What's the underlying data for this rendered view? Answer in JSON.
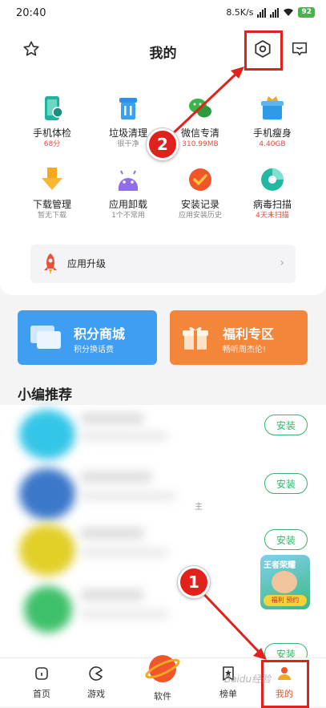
{
  "status_bar": {
    "time": "20:40",
    "speed": "8.5K/s",
    "battery": "92"
  },
  "header": {
    "title": "我的"
  },
  "tools": [
    {
      "label": "手机体检",
      "sub": "68分",
      "sub_red": true,
      "icon": "phone-check-icon",
      "color": "#23b09c"
    },
    {
      "label": "垃圾清理",
      "sub": "很干净",
      "sub_red": false,
      "icon": "trash-icon",
      "color": "#2f8fe6"
    },
    {
      "label": "微信专清",
      "sub": "310.99MB",
      "sub_red": true,
      "icon": "wechat-icon",
      "color": "#3ab54a"
    },
    {
      "label": "手机瘦身",
      "sub": "4.40GB",
      "sub_red": true,
      "icon": "slim-box-icon",
      "color": "#2f9be6"
    },
    {
      "label": "下载管理",
      "sub": "暂无下载",
      "sub_red": false,
      "icon": "download-icon",
      "color": "#f5a91a"
    },
    {
      "label": "应用卸载",
      "sub": "1个不常用",
      "sub_red": false,
      "icon": "android-icon",
      "color": "#8f6ee8"
    },
    {
      "label": "安装记录",
      "sub": "应用安装历史",
      "sub_red": false,
      "icon": "install-record-icon",
      "color": "#f0552c"
    },
    {
      "label": "病毒扫描",
      "sub": "4天未扫描",
      "sub_red": true,
      "icon": "virus-scan-icon",
      "color": "#22b8a1"
    }
  ],
  "upgrade": {
    "label": "应用升级"
  },
  "banners": {
    "points": {
      "title": "积分商城",
      "sub": "积分换话费",
      "color": "#3f9ef2"
    },
    "welfare": {
      "title": "福利专区",
      "sub": "畅听周杰伦!",
      "color": "#f4863a"
    }
  },
  "section": {
    "title": "小编推荐"
  },
  "apps": [
    {
      "install": "安装",
      "color": "#34c6e8"
    },
    {
      "install": "安装",
      "color": "#3b78c9"
    },
    {
      "install": "安装",
      "color": "#e2cf28"
    },
    {
      "install": "安装",
      "color": "#3fc06a"
    }
  ],
  "list_fragment": "主",
  "promo": {
    "line1": "王者荣耀",
    "line2": "福利 预约"
  },
  "nav": [
    {
      "label": "首页"
    },
    {
      "label": "游戏"
    },
    {
      "label": "软件"
    },
    {
      "label": "榜单"
    },
    {
      "label": "我的"
    }
  ],
  "annotations": {
    "marker1": "1",
    "marker2": "2"
  },
  "watermark": "Baidu经验",
  "colors": {
    "accent_green": "#38b36b",
    "annotation_red": "#e0211c"
  }
}
